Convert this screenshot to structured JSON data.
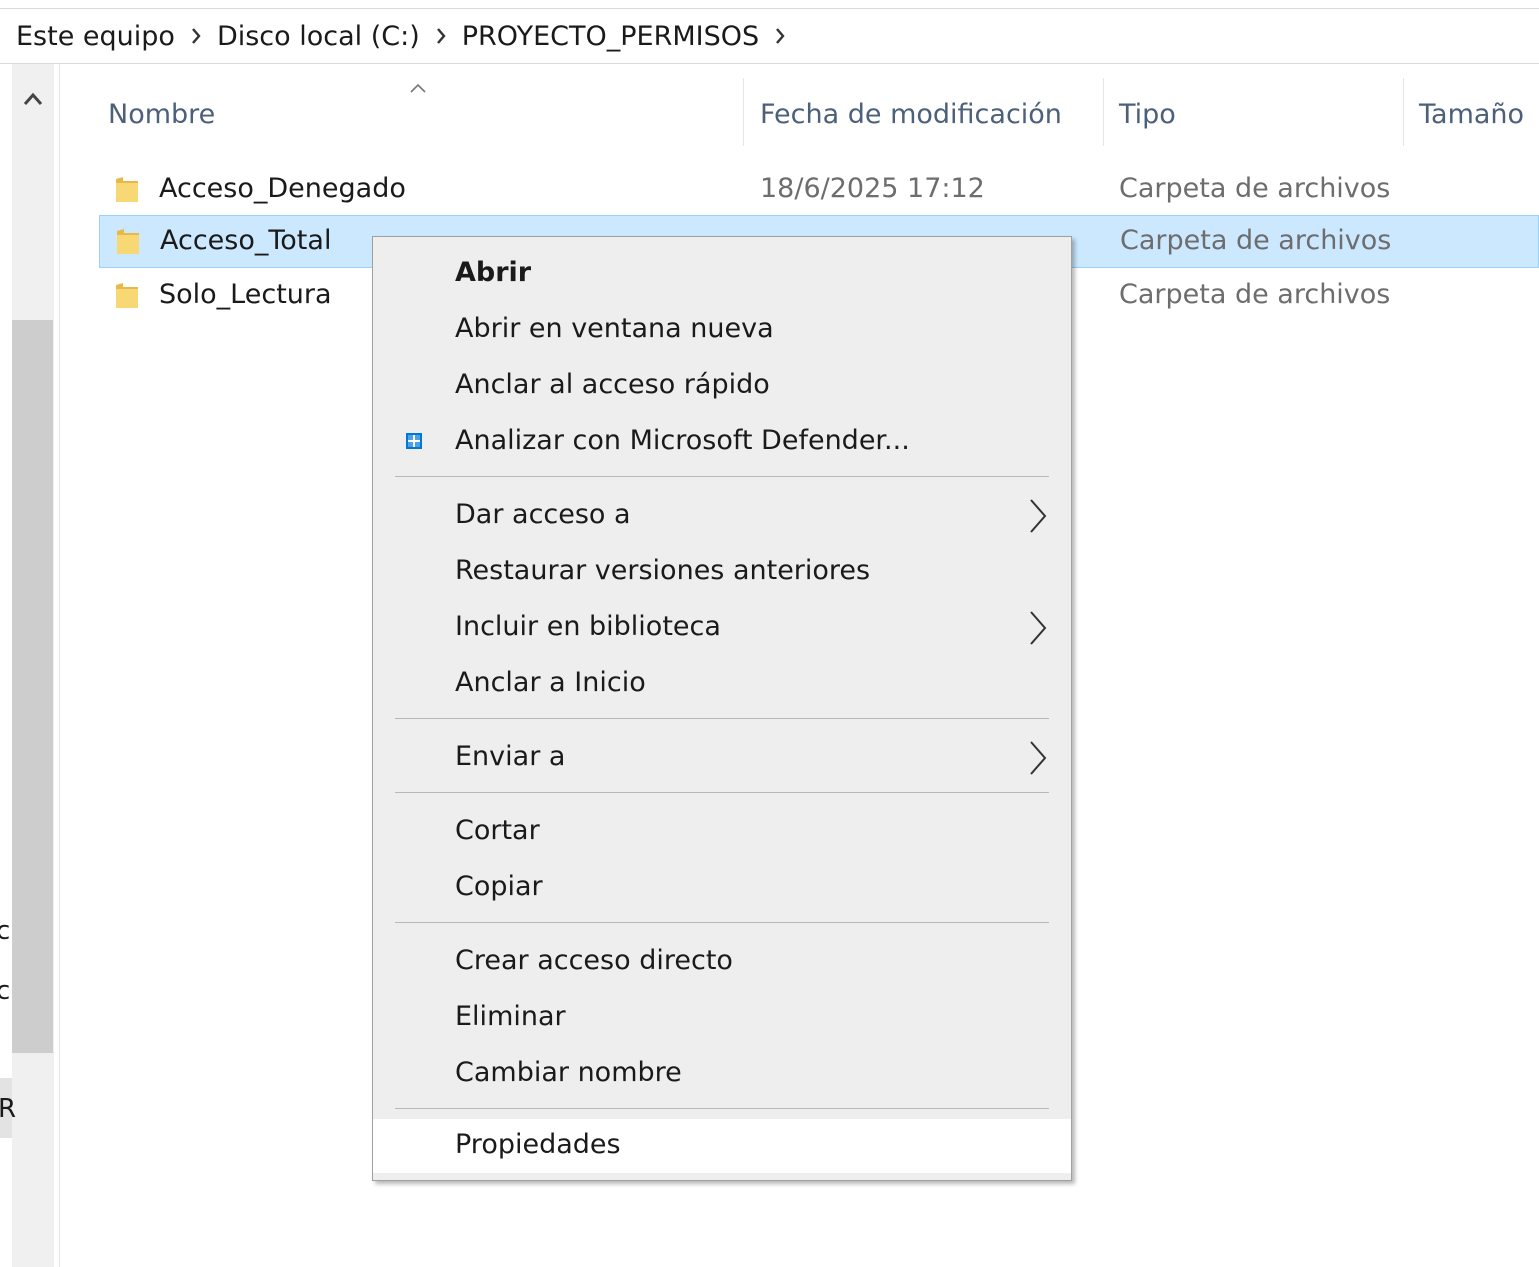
{
  "breadcrumb": {
    "items": [
      "Este equipo",
      "Disco local (C:)",
      "PROYECTO_PERMISOS"
    ]
  },
  "nav_pane": {
    "clipped_labels": [
      ")",
      "c",
      "c",
      "R"
    ]
  },
  "columns": {
    "name": "Nombre",
    "date": "Fecha de modificación",
    "type": "Tipo",
    "size": "Tamaño"
  },
  "files": [
    {
      "name": "Acceso_Denegado",
      "date": "18/6/2025 17:12",
      "type": "Carpeta de archivos",
      "selected": false
    },
    {
      "name": "Acceso_Total",
      "date": "",
      "type": "Carpeta de archivos",
      "selected": true
    },
    {
      "name": "Solo_Lectura",
      "date": "",
      "type": "Carpeta de archivos",
      "selected": false
    }
  ],
  "context_menu": {
    "items": [
      {
        "label": "Abrir",
        "bold": true
      },
      {
        "label": "Abrir en ventana nueva"
      },
      {
        "label": "Anclar al acceso rápido"
      },
      {
        "label": "Analizar con Microsoft Defender...",
        "icon": "defender-shield-icon"
      },
      {
        "label": "Dar acceso a",
        "submenu": true
      },
      {
        "label": "Restaurar versiones anteriores"
      },
      {
        "label": "Incluir en biblioteca",
        "submenu": true
      },
      {
        "label": "Anclar a Inicio"
      },
      {
        "label": "Enviar a",
        "submenu": true
      },
      {
        "label": "Cortar"
      },
      {
        "label": "Copiar"
      },
      {
        "label": "Crear acceso directo"
      },
      {
        "label": "Eliminar"
      },
      {
        "label": "Cambiar nombre"
      },
      {
        "label": "Propiedades",
        "hovered": true
      }
    ]
  },
  "colors": {
    "selection_bg": "#cce8ff",
    "selection_border": "#99d1ff",
    "header_text": "#4c607a",
    "menu_bg": "#eeeeee",
    "folder_yellow": "#f8d775",
    "defender_blue": "#0078d4"
  }
}
